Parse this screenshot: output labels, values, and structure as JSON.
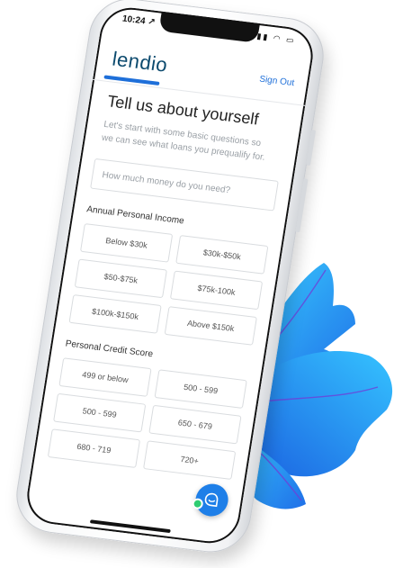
{
  "status_bar": {
    "time": "10:24 ↗",
    "icons": "▮▮▮ ◠ ▭"
  },
  "header": {
    "logo": "lendio",
    "sign_out": "Sign Out"
  },
  "form": {
    "title": "Tell us about yourself",
    "subtitle": "Let's start with some basic questions so we can see what loans you prequalify for.",
    "amount_placeholder": "How much money do you need?"
  },
  "income": {
    "label": "Annual Personal Income",
    "options": [
      "Below $30k",
      "$30k-$50k",
      "$50-$75k",
      "$75k-100k",
      "$100k-$150k",
      "Above $150k"
    ]
  },
  "credit": {
    "label": "Personal Credit Score",
    "options": [
      "499 or below",
      "500 - 599",
      "500 - 599",
      "650 - 679",
      "680 - 719",
      "720+"
    ]
  },
  "colors": {
    "accent": "#1e6fd9",
    "leaf": "#1f8ff0",
    "chat": "#1e7fe8"
  },
  "icons": {
    "chat": "chat-bubble-icon"
  }
}
